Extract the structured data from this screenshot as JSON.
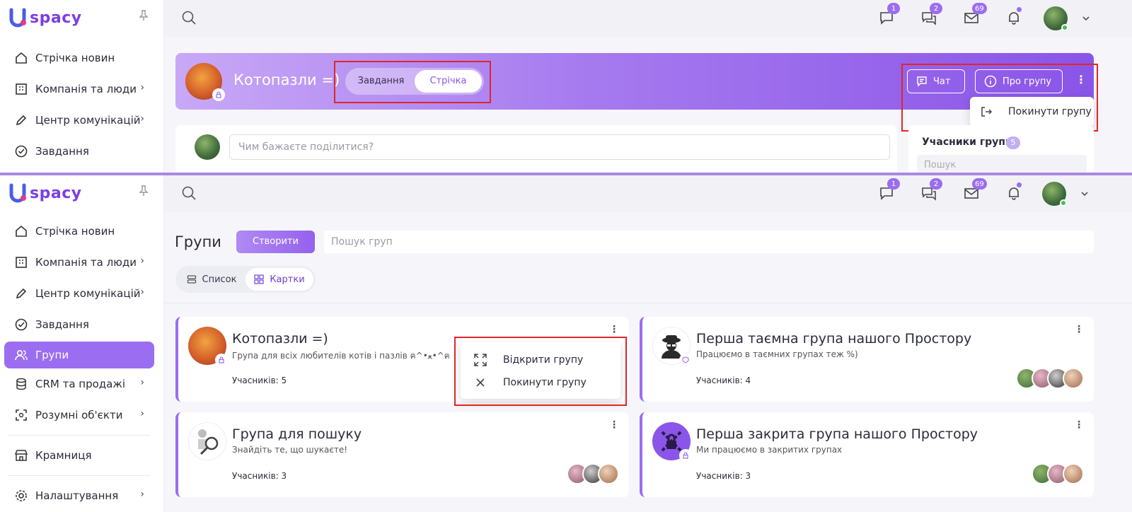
{
  "app": {
    "brand_letter": "U",
    "brand_text": "spacy"
  },
  "topbar": {
    "badges": {
      "chat": "1",
      "messages": "2",
      "mail": "69"
    }
  },
  "sidebar_top": {
    "items": [
      {
        "label": "Стрічка новин",
        "icon": "home-icon"
      },
      {
        "label": "Компанія та люди",
        "icon": "building-icon"
      },
      {
        "label": "Центр комунікацій",
        "icon": "pen-icon"
      },
      {
        "label": "Завдання",
        "icon": "check-circle-icon"
      }
    ]
  },
  "group_view": {
    "title": "Котопазли =)",
    "tabs": [
      "Завдання",
      "Стрічка"
    ],
    "chat_label": "Чат",
    "about_label": "Про групу",
    "menu_leave": "Покинути групу",
    "post_placeholder": "Чим бажаєте поділитися?",
    "members_title": "Учасники групи",
    "members_count": "5",
    "members_search": "Пошук"
  },
  "sidebar_bottom": {
    "items": [
      {
        "label": "Стрічка новин",
        "icon": "home-icon"
      },
      {
        "label": "Компанія та люди",
        "icon": "building-icon"
      },
      {
        "label": "Центр комунікацій",
        "icon": "pen-icon"
      },
      {
        "label": "Завдання",
        "icon": "check-circle-icon"
      },
      {
        "label": "Групи",
        "icon": "users-icon"
      },
      {
        "label": "CRM та продажі",
        "icon": "database-icon"
      },
      {
        "label": "Розумні об'єкти",
        "icon": "scan-icon"
      },
      {
        "label": "Крамниця",
        "icon": "store-icon"
      },
      {
        "label": "Налаштування",
        "icon": "gear-icon"
      }
    ]
  },
  "groups_page": {
    "title": "Групи",
    "create_label": "Створити",
    "search_placeholder": "Пошук груп",
    "view_list": "Список",
    "view_cards": "Картки",
    "context_menu": {
      "open": "Відкрити групу",
      "leave": "Покинути групу"
    },
    "cards": [
      {
        "title": "Котопазли =)",
        "desc": "Група для всіх любителів котів і пазлів ฅ^•ﻌ•^ฅ",
        "members": "Учасників: 5"
      },
      {
        "title": "Перша таємна група нашого Простору",
        "desc": "Працюємо в таємних групах теж %)",
        "members": "Учасників: 4"
      },
      {
        "title": "Група для пошуку",
        "desc": "Знайдіть те, що шукаєте!",
        "members": "Учасників: 3"
      },
      {
        "title": "Перша закрита група нашого Простору",
        "desc": "Ми працюємо в закритих групах",
        "members": "Учасників: 3"
      }
    ]
  },
  "colors": {
    "accent": "#9b6df0",
    "highlight": "#e0262a"
  }
}
